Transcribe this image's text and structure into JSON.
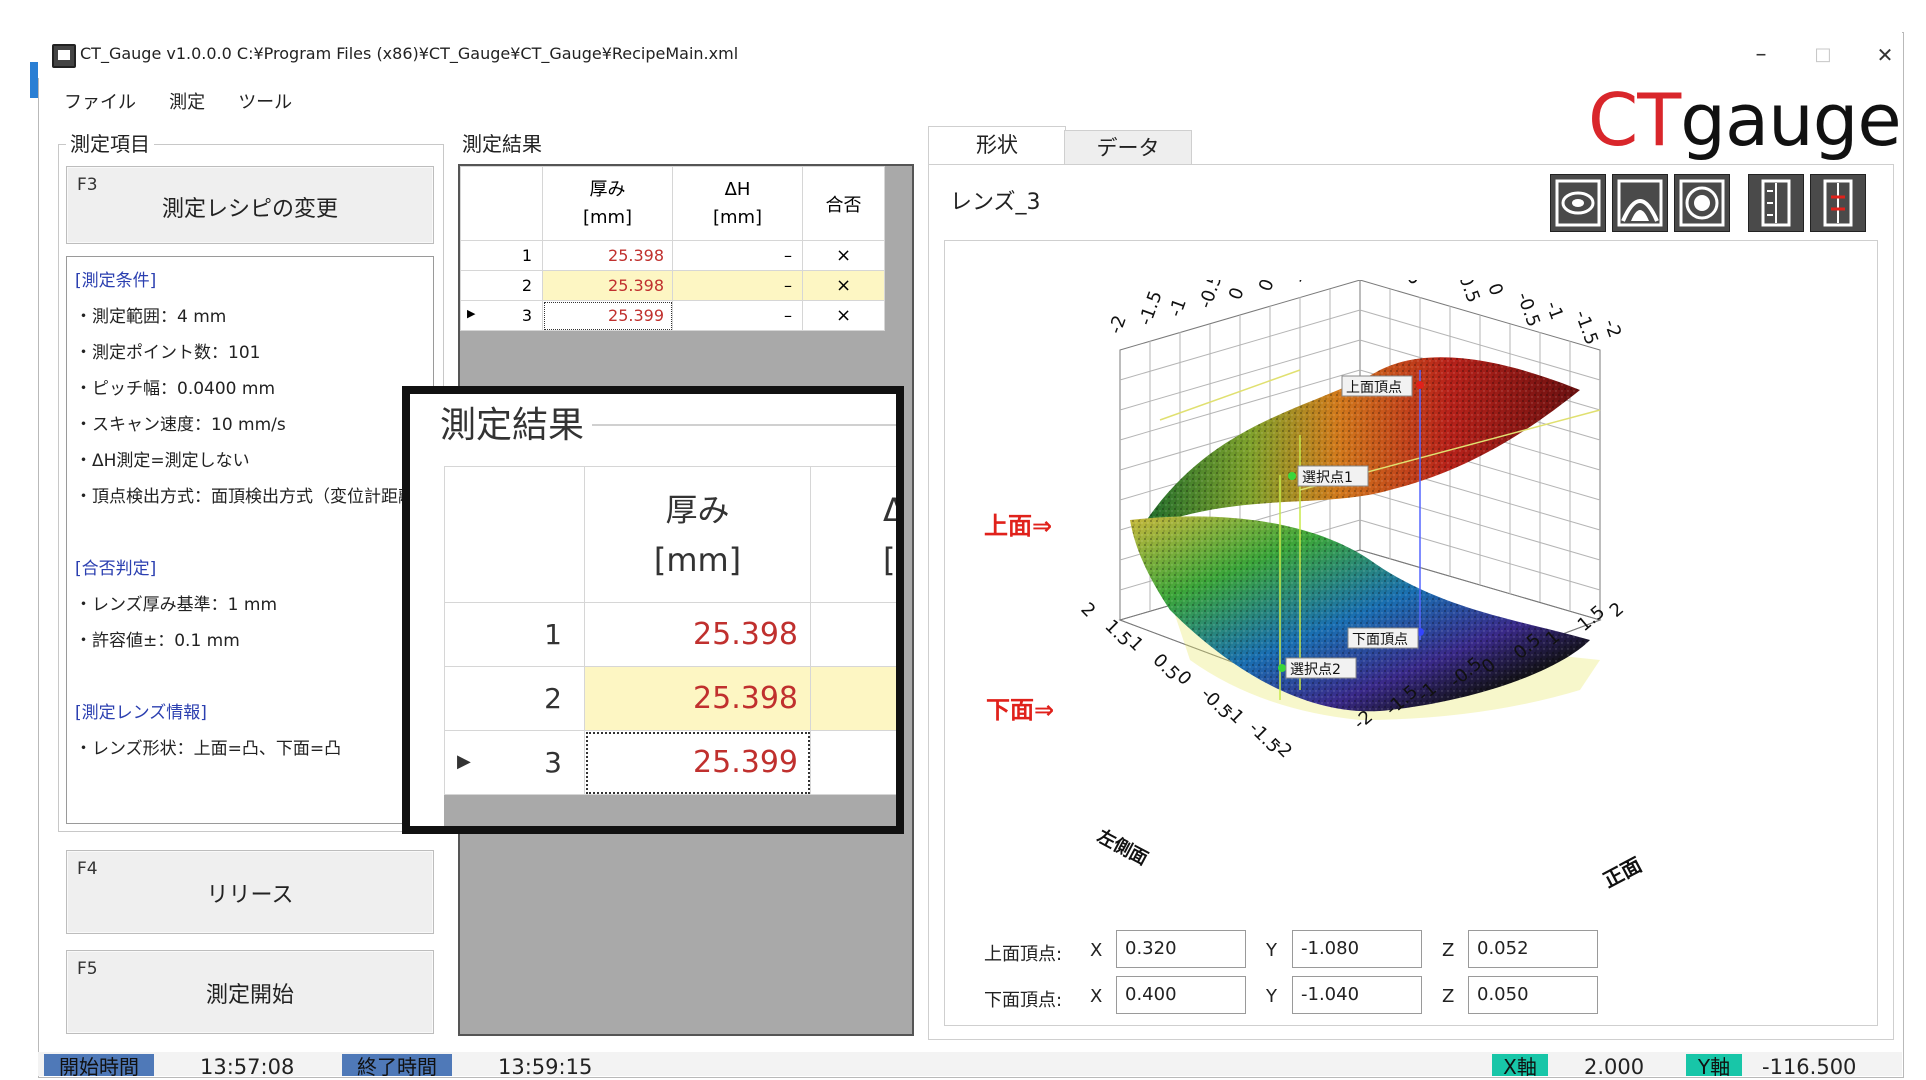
{
  "window": {
    "title": "CT_Gauge v1.0.0.0    C:¥Program Files (x86)¥CT_Gauge¥CT_Gauge¥RecipeMain.xml",
    "minimize": "–",
    "maximize": "□",
    "close": "✕"
  },
  "menu": [
    "ファイル",
    "測定",
    "ツール"
  ],
  "logo": {
    "ct": "CT",
    "gauge": "gauge",
    "accent": "#d9262b"
  },
  "left_panel": {
    "group_title": "測定項目",
    "f3_key": "F3",
    "f3_label": "測定レシピの変更",
    "info": [
      {
        "kind": "section",
        "text": "[測定条件]"
      },
      {
        "kind": "line",
        "text": "・測定範囲：4 mm"
      },
      {
        "kind": "line",
        "text": "・測定ポイント数：101"
      },
      {
        "kind": "line",
        "text": "・ピッチ幅：0.0400 mm"
      },
      {
        "kind": "line",
        "text": "・スキャン速度：10 mm/s"
      },
      {
        "kind": "line",
        "text": "・ΔH測定=測定しない"
      },
      {
        "kind": "line",
        "text": "・頂点検出方式：面頂検出方式（変位計距離"
      },
      {
        "kind": "blank",
        "text": ""
      },
      {
        "kind": "section",
        "text": "[合否判定]"
      },
      {
        "kind": "line",
        "text": "・レンズ厚み基準：1 mm"
      },
      {
        "kind": "line",
        "text": "・許容値±：0.1 mm"
      },
      {
        "kind": "blank",
        "text": ""
      },
      {
        "kind": "section",
        "text": "[測定レンズ情報]"
      },
      {
        "kind": "line",
        "text": "・レンズ形状：上面=凸、下面=凸"
      }
    ],
    "f4_key": "F4",
    "f4_label": "リリース",
    "f5_key": "F5",
    "f5_label": "測定開始"
  },
  "results": {
    "group_title": "測定結果",
    "col_thickness_1": "厚み",
    "col_thickness_2": "[mm]",
    "col_dh_1": "ΔH",
    "col_dh_2": "[mm]",
    "col_pass": "合否",
    "rows": [
      {
        "no": "1",
        "thickness": "25.398",
        "dh": "–",
        "pass": "×",
        "highlight": false,
        "current": false
      },
      {
        "no": "2",
        "thickness": "25.398",
        "dh": "–",
        "pass": "×",
        "highlight": true,
        "current": false
      },
      {
        "no": "3",
        "thickness": "25.399",
        "dh": "–",
        "pass": "×",
        "highlight": false,
        "current": true
      }
    ],
    "current_marker": "▶",
    "value_color": "#c0302e",
    "highlight_color": "#fdf6c3"
  },
  "zoom": {
    "title": "測定結果",
    "col_1": "厚み",
    "col_2": "[mm]",
    "cut_col": "Δ",
    "cut_col_2": "[r",
    "rows": [
      {
        "no": "1",
        "thickness": "25.398"
      },
      {
        "no": "2",
        "thickness": "25.398"
      },
      {
        "no": "3",
        "thickness": "25.399"
      }
    ]
  },
  "view": {
    "tabs": [
      "形状",
      "データ"
    ],
    "lens_name": "レンズ_3",
    "toolbar_icons": [
      "view-box-icon",
      "view-arch-icon",
      "view-circle-icon",
      "view-frame-icon",
      "view-ruler-icon"
    ],
    "upper_label": "上面⇒",
    "lower_label": "下面⇒",
    "label_color": "#e0211b",
    "plot_labels": {
      "upper_vertex": "上面頂点",
      "lower_vertex": "下面頂点",
      "select1": "選択点1",
      "select2": "選択点2",
      "axis_front": "正面",
      "axis_side": "左側面"
    },
    "back_left_ticks": [
      "-2",
      "-1.5",
      "-1",
      "-0.5",
      "0",
      "0.5",
      "1",
      "1.5",
      "2"
    ],
    "back_right_ticks": [
      "2",
      "1.5",
      "1",
      "0.5",
      "0",
      "-0.5",
      "-1",
      "-1.5",
      "-2"
    ],
    "front_left_ticks": [
      "2",
      "1.5",
      "1",
      "0.5",
      "0",
      "-0.5",
      "-1",
      "-1.5",
      "-2"
    ],
    "front_right_ticks": [
      "-2",
      "-1.5",
      "-1",
      "-0.5",
      "0",
      "0.5",
      "1",
      "1.5",
      "2"
    ],
    "upper_row_label": "上面頂点:",
    "lower_row_label": "下面頂点:",
    "x_label": "X",
    "y_label": "Y",
    "z_label": "Z",
    "upper": {
      "x": "0.320",
      "y": "-1.080",
      "z": "0.052"
    },
    "lower": {
      "x": "0.400",
      "y": "-1.040",
      "z": "0.050"
    }
  },
  "status": {
    "start_label": "開始時間",
    "start_time": "13:57:08",
    "end_label": "終了時間",
    "end_time": "13:59:15",
    "x_axis_label": "X軸",
    "x_axis_value": "2.000",
    "y_axis_label": "Y軸",
    "y_axis_value": "-116.500",
    "badge_blue": "#4f79b8",
    "badge_teal": "#18c6a8"
  }
}
